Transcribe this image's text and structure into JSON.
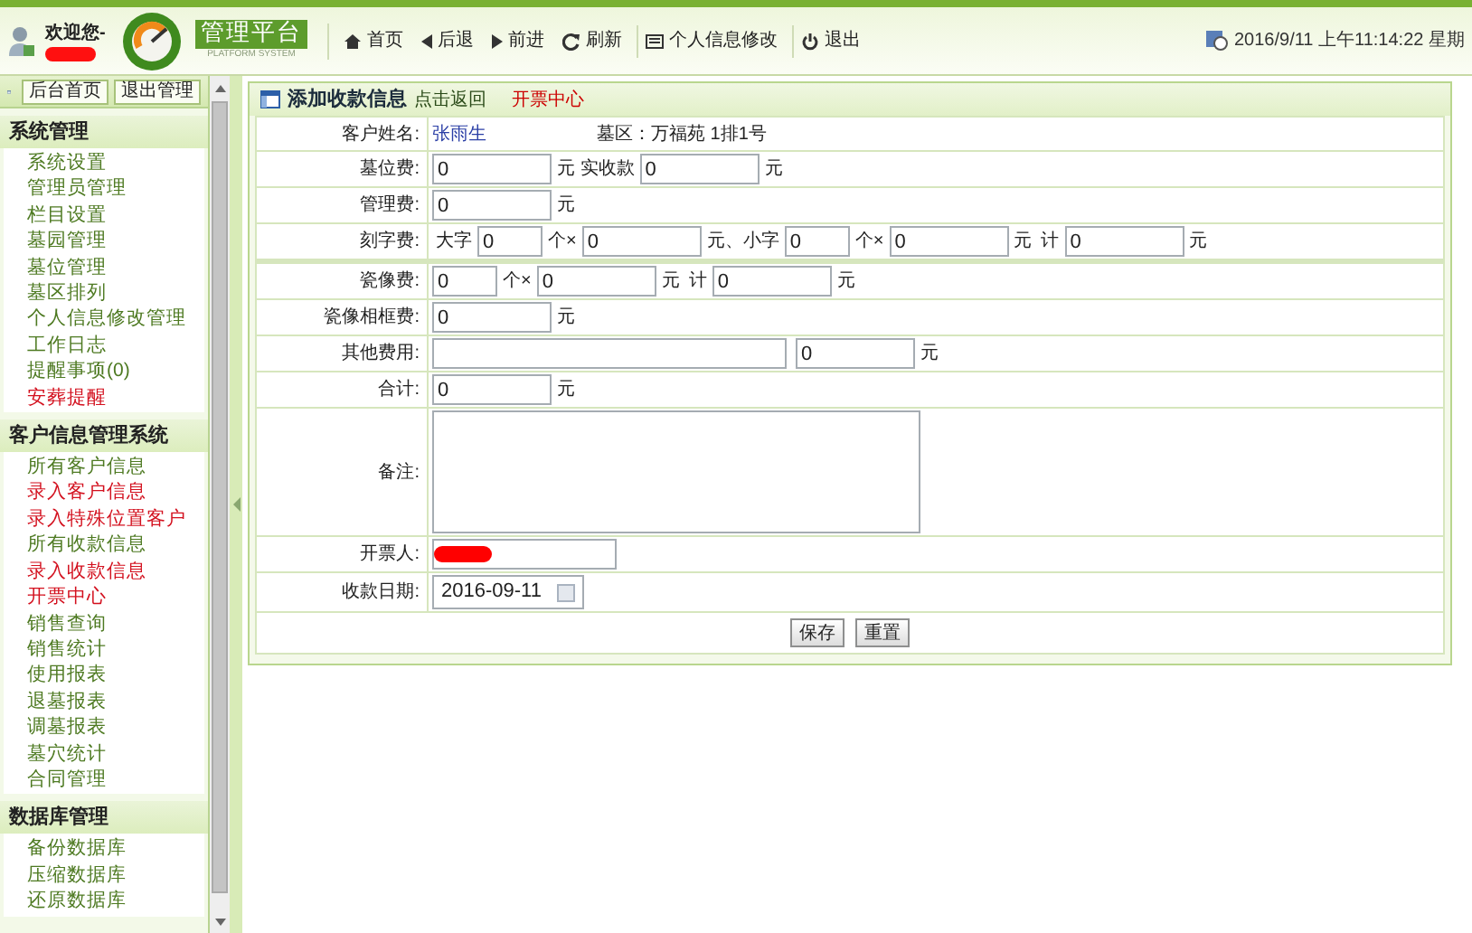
{
  "header": {
    "welcome": "欢迎您-",
    "user_redacted": true,
    "brand": "管理平台",
    "brand_sub": "PLATFORM SYSTEM",
    "nav": [
      {
        "label": "首页"
      },
      {
        "label": "后退"
      },
      {
        "label": "前进"
      },
      {
        "label": "刷新"
      },
      {
        "label": "个人信息修改"
      },
      {
        "label": "退出"
      }
    ],
    "clock": "2016/9/11 上午11:14:22 星期"
  },
  "sidebar": {
    "buttons": [
      "后台首页",
      "退出管理"
    ],
    "sections": [
      {
        "title": "系统管理",
        "items": [
          {
            "label": "系统设置",
            "highlight": false
          },
          {
            "label": "管理员管理",
            "highlight": false
          },
          {
            "label": "栏目设置",
            "highlight": false
          },
          {
            "label": "墓园管理",
            "highlight": false
          },
          {
            "label": "墓位管理",
            "highlight": false
          },
          {
            "label": "墓区排列",
            "highlight": false
          },
          {
            "label": "个人信息修改管理",
            "highlight": false
          },
          {
            "label": "工作日志",
            "highlight": false
          },
          {
            "label": "提醒事项(0)",
            "highlight": false
          },
          {
            "label": "安葬提醒",
            "highlight": true
          }
        ]
      },
      {
        "title": "客户信息管理系统",
        "items": [
          {
            "label": "所有客户信息",
            "highlight": false
          },
          {
            "label": "录入客户信息",
            "highlight": true
          },
          {
            "label": "录入特殊位置客户",
            "highlight": true
          },
          {
            "label": "所有收款信息",
            "highlight": false
          },
          {
            "label": "录入收款信息",
            "highlight": true
          },
          {
            "label": "开票中心",
            "highlight": true
          },
          {
            "label": "销售查询",
            "highlight": false
          },
          {
            "label": "销售统计",
            "highlight": false
          },
          {
            "label": "使用报表",
            "highlight": false
          },
          {
            "label": "退墓报表",
            "highlight": false
          },
          {
            "label": "调墓报表",
            "highlight": false
          },
          {
            "label": "墓穴统计",
            "highlight": false
          },
          {
            "label": "合同管理",
            "highlight": false
          }
        ]
      },
      {
        "title": "数据库管理",
        "items": [
          {
            "label": "备份数据库",
            "highlight": false
          },
          {
            "label": "压缩数据库",
            "highlight": false
          },
          {
            "label": "还原数据库",
            "highlight": false
          }
        ]
      }
    ]
  },
  "panel": {
    "title": "添加收款信息",
    "back_link": "点击返回",
    "section_link": "开票中心",
    "rows": [
      {
        "label": "客户姓名:",
        "parts": [
          {
            "kind": "name",
            "value": "张雨生"
          },
          {
            "kind": "text",
            "value": "墓区：万福苑 1排1号"
          }
        ]
      },
      {
        "label": "墓位费:",
        "parts": [
          {
            "kind": "input",
            "value": "0"
          },
          {
            "kind": "text",
            "value": "元 实收款"
          },
          {
            "kind": "input",
            "value": "0"
          },
          {
            "kind": "text",
            "value": "元"
          }
        ]
      },
      {
        "label": "管理费:",
        "parts": [
          {
            "kind": "input",
            "value": "0"
          },
          {
            "kind": "text",
            "value": "元"
          }
        ]
      },
      {
        "label": "刻字费:",
        "parts": [
          {
            "kind": "text",
            "value": "大字"
          },
          {
            "kind": "short",
            "value": "0"
          },
          {
            "kind": "text",
            "value": "个×"
          },
          {
            "kind": "input",
            "value": "0"
          },
          {
            "kind": "text",
            "value": "元、小字"
          },
          {
            "kind": "short",
            "value": "0"
          },
          {
            "kind": "text",
            "value": "个×"
          },
          {
            "kind": "input",
            "value": "0"
          },
          {
            "kind": "text",
            "value": "元"
          },
          {
            "kind": "text",
            "value": "计"
          },
          {
            "kind": "input",
            "value": "0"
          },
          {
            "kind": "text",
            "value": "元"
          }
        ]
      },
      {
        "label": "瓷像费:",
        "parts": [
          {
            "kind": "short",
            "value": "0"
          },
          {
            "kind": "text",
            "value": "个×"
          },
          {
            "kind": "input",
            "value": "0"
          },
          {
            "kind": "text",
            "value": "元"
          },
          {
            "kind": "text",
            "value": "计"
          },
          {
            "kind": "input",
            "value": "0"
          },
          {
            "kind": "text",
            "value": "元"
          }
        ]
      },
      {
        "label": "瓷像相框费:",
        "parts": [
          {
            "kind": "input",
            "value": "0"
          },
          {
            "kind": "text",
            "value": "元"
          }
        ]
      },
      {
        "label": "其他费用:",
        "parts": [
          {
            "kind": "wide"
          },
          {
            "kind": "input",
            "value": "0"
          },
          {
            "kind": "text",
            "value": "元"
          }
        ]
      },
      {
        "label": "合计:",
        "parts": [
          {
            "kind": "input",
            "value": "0"
          },
          {
            "kind": "text",
            "value": "元"
          }
        ]
      },
      {
        "label": "备注:",
        "parts": [
          {
            "kind": "textarea"
          }
        ]
      },
      {
        "label": "开票人:",
        "parts": [
          {
            "kind": "redacted"
          }
        ]
      },
      {
        "label": "收款日期:",
        "parts": [
          {
            "kind": "date",
            "value": "2016-09-11"
          }
        ]
      }
    ],
    "buttons": [
      "保存",
      "重置"
    ]
  }
}
